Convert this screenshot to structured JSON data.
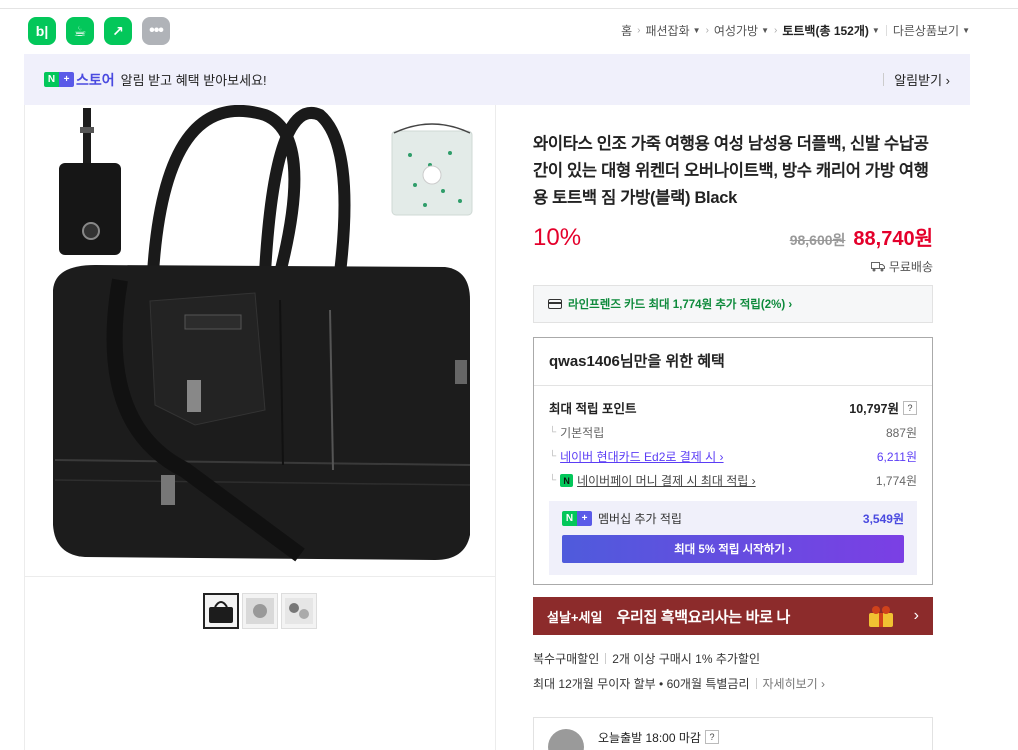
{
  "apps": [
    {
      "label": "b|",
      "icon": "blog-icon"
    },
    {
      "label": "☕",
      "icon": "cafe-icon"
    },
    {
      "label": "↗",
      "icon": "naver-shortcut-icon"
    },
    {
      "label": "•••",
      "icon": "more-icon"
    }
  ],
  "breadcrumb": {
    "home": "홈",
    "cat1": "패션잡화",
    "cat2": "여성가방",
    "cat3": "토트백(총 152개)",
    "other": "다른상품보기"
  },
  "store_banner": {
    "brand_n": "N",
    "brand_plus": "+",
    "store_name": "스토어",
    "message": "알림 받고 혜택 받아보세요!",
    "alarm_label": "알림받기 ›"
  },
  "product": {
    "title": "와이타스 인조 가죽 여행용 여성 남성용 더플백, 신발 수납공간이 있는 대형 위켄더 오버나이트백, 방수 캐리어 가방 여행용 토트백 짐 가방(블랙) Black",
    "discount": "10%",
    "original_price": "98,600원",
    "final_price": "88,740원",
    "shipping": "무료배송"
  },
  "card_offer": "라인프렌즈 카드 최대 1,774원 추가 적립(2%) ›",
  "benefit": {
    "title": "qwas1406님만을 위한 혜택",
    "max_label": "최대 적립 포인트",
    "max_value": "10,797원",
    "help": "?",
    "rows": [
      {
        "label": "기본적립",
        "value": "887원"
      },
      {
        "label": "네이버 현대카드 Ed2로 결제 시 ›",
        "value": "6,211원"
      },
      {
        "label": "네이버페이 머니 결제 시 최대 적립 ›",
        "value": "1,774원"
      }
    ],
    "npay_icon": "N",
    "member_label": "멤버십 추가 적립",
    "member_value": "3,549원",
    "member_btn": "최대 5% 적립 시작하기 ›"
  },
  "promo": {
    "tag": "설날+세일",
    "text": "우리집 흑백요리사는 바로 나",
    "arrow": "›"
  },
  "extra": {
    "multi_label": "복수구매할인",
    "multi_value": "2개 이상 구매시 1% 추가할인",
    "installment": "최대 12개월 무이자 할부 • 60개월 특별금리",
    "detail": "자세히보기 ›"
  },
  "dispatch": {
    "label": "오늘출발 18:00 마감",
    "help": "?"
  },
  "colors": {
    "accent_red": "#e4002b",
    "naver_green": "#03c75a",
    "store_purple": "#4a4ae0",
    "promo_bg": "#8c2b2b"
  }
}
